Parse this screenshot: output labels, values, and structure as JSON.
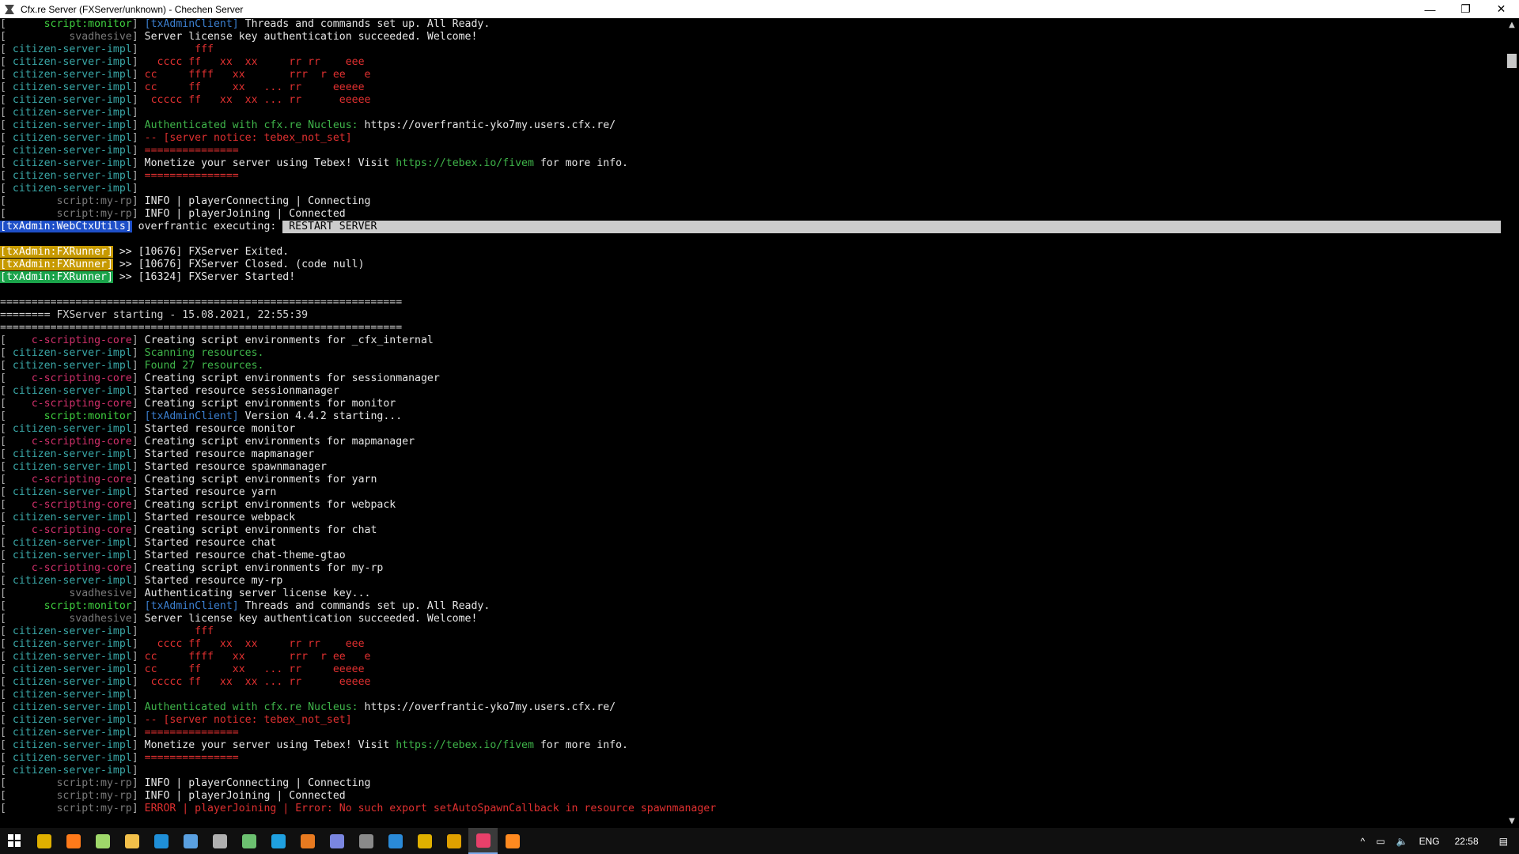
{
  "window": {
    "title": "Cfx.re Server (FXServer/unknown) - Chechen Server",
    "minimize": "—",
    "maximize": "❐",
    "close": "✕"
  },
  "console": {
    "lines": [
      [
        [
          "[      ",
          "b"
        ],
        [
          "script:monitor",
          "monitor"
        ],
        [
          "] ",
          "b"
        ],
        [
          "[txAdminClient]",
          "client"
        ],
        [
          " Threads and commands set up. All Ready.",
          "white"
        ]
      ],
      [
        [
          "[          ",
          "b"
        ],
        [
          "svadhesive",
          "svad"
        ],
        [
          "] ",
          "b"
        ],
        [
          "Server license key authentication succeeded. Welcome!",
          "white"
        ]
      ],
      [
        [
          "[ ",
          "b"
        ],
        [
          "citizen-server-impl",
          "csi"
        ],
        [
          "] ",
          "b"
        ],
        [
          "        fff",
          "red"
        ]
      ],
      [
        [
          "[ ",
          "b"
        ],
        [
          "citizen-server-impl",
          "csi"
        ],
        [
          "] ",
          "b"
        ],
        [
          "  cccc ff   xx  xx     rr rr    eee",
          "red"
        ]
      ],
      [
        [
          "[ ",
          "b"
        ],
        [
          "citizen-server-impl",
          "csi"
        ],
        [
          "] ",
          "b"
        ],
        [
          "cc     ffff   xx       rrr  r ee   e",
          "red"
        ]
      ],
      [
        [
          "[ ",
          "b"
        ],
        [
          "citizen-server-impl",
          "csi"
        ],
        [
          "] ",
          "b"
        ],
        [
          "cc     ff     xx   ... rr     eeeee",
          "red"
        ]
      ],
      [
        [
          "[ ",
          "b"
        ],
        [
          "citizen-server-impl",
          "csi"
        ],
        [
          "] ",
          "b"
        ],
        [
          " ccccc ff   xx  xx ... rr      eeeee",
          "red"
        ]
      ],
      [
        [
          "[ ",
          "b"
        ],
        [
          "citizen-server-impl",
          "csi"
        ],
        [
          "]",
          "b"
        ]
      ],
      [
        [
          "[ ",
          "b"
        ],
        [
          "citizen-server-impl",
          "csi"
        ],
        [
          "] ",
          "b"
        ],
        [
          "Authenticated with cfx.re Nucleus: ",
          "green"
        ],
        [
          "https://overfrantic-yko7my.users.cfx.re/",
          "white"
        ]
      ],
      [
        [
          "[ ",
          "b"
        ],
        [
          "citizen-server-impl",
          "csi"
        ],
        [
          "] ",
          "b"
        ],
        [
          "-- [server notice: tebex_not_set]",
          "red"
        ]
      ],
      [
        [
          "[ ",
          "b"
        ],
        [
          "citizen-server-impl",
          "csi"
        ],
        [
          "] ",
          "b"
        ],
        [
          "===============",
          "red"
        ]
      ],
      [
        [
          "[ ",
          "b"
        ],
        [
          "citizen-server-impl",
          "csi"
        ],
        [
          "] ",
          "b"
        ],
        [
          "Monetize your server using Tebex! Visit ",
          "white"
        ],
        [
          "https://tebex.io/fivem",
          "green"
        ],
        [
          " for more info.",
          "white"
        ]
      ],
      [
        [
          "[ ",
          "b"
        ],
        [
          "citizen-server-impl",
          "csi"
        ],
        [
          "] ",
          "b"
        ],
        [
          "===============",
          "red"
        ]
      ],
      [
        [
          "[ ",
          "b"
        ],
        [
          "citizen-server-impl",
          "csi"
        ],
        [
          "]",
          "b"
        ]
      ],
      [
        [
          "[        ",
          "b"
        ],
        [
          "script:my-rp",
          "myrp"
        ],
        [
          "] ",
          "b"
        ],
        [
          "INFO | playerConnecting | Connecting",
          "white"
        ]
      ],
      [
        [
          "[        ",
          "b"
        ],
        [
          "script:my-rp",
          "myrp"
        ],
        [
          "] ",
          "b"
        ],
        [
          "INFO | playerJoining | Connected",
          "white"
        ]
      ],
      [
        [
          "[txAdmin:WebCtxUtils]",
          "webctx"
        ],
        [
          " overfrantic executing: ",
          "white"
        ],
        [
          " RESTART SERVER",
          "cmd"
        ]
      ],
      [],
      [
        [
          "[txAdmin:FXRunner]",
          "fxr-y"
        ],
        [
          " >> [10676] FXServer Exited.",
          "white"
        ]
      ],
      [
        [
          "[txAdmin:FXRunner]",
          "fxr-y"
        ],
        [
          " >> [10676] FXServer Closed. (code null)",
          "white"
        ]
      ],
      [
        [
          "[txAdmin:FXRunner]",
          "fxr-g"
        ],
        [
          " >> [16324] FXServer Started!",
          "white"
        ]
      ],
      [],
      [
        [
          "================================================================",
          "sep"
        ]
      ],
      [
        [
          "======== FXServer starting - 15.08.2021, 22:55:39",
          "sep"
        ]
      ],
      [
        [
          "================================================================",
          "sep"
        ]
      ],
      [
        [
          "[    ",
          "b"
        ],
        [
          "c-scripting-core",
          "core"
        ],
        [
          "] ",
          "b"
        ],
        [
          "Creating script environments for _cfx_internal",
          "white"
        ]
      ],
      [
        [
          "[ ",
          "b"
        ],
        [
          "citizen-server-impl",
          "csi"
        ],
        [
          "] ",
          "b"
        ],
        [
          "Scanning resources.",
          "green"
        ]
      ],
      [
        [
          "[ ",
          "b"
        ],
        [
          "citizen-server-impl",
          "csi"
        ],
        [
          "] ",
          "b"
        ],
        [
          "Found 27 resources.",
          "green"
        ]
      ],
      [
        [
          "[    ",
          "b"
        ],
        [
          "c-scripting-core",
          "core"
        ],
        [
          "] ",
          "b"
        ],
        [
          "Creating script environments for sessionmanager",
          "white"
        ]
      ],
      [
        [
          "[ ",
          "b"
        ],
        [
          "citizen-server-impl",
          "csi"
        ],
        [
          "] ",
          "b"
        ],
        [
          "Started resource sessionmanager",
          "white"
        ]
      ],
      [
        [
          "[    ",
          "b"
        ],
        [
          "c-scripting-core",
          "core"
        ],
        [
          "] ",
          "b"
        ],
        [
          "Creating script environments for monitor",
          "white"
        ]
      ],
      [
        [
          "[      ",
          "b"
        ],
        [
          "script:monitor",
          "monitor"
        ],
        [
          "] ",
          "b"
        ],
        [
          "[txAdminClient]",
          "client"
        ],
        [
          " Version 4.4.2 starting...",
          "white"
        ]
      ],
      [
        [
          "[ ",
          "b"
        ],
        [
          "citizen-server-impl",
          "csi"
        ],
        [
          "] ",
          "b"
        ],
        [
          "Started resource monitor",
          "white"
        ]
      ],
      [
        [
          "[    ",
          "b"
        ],
        [
          "c-scripting-core",
          "core"
        ],
        [
          "] ",
          "b"
        ],
        [
          "Creating script environments for mapmanager",
          "white"
        ]
      ],
      [
        [
          "[ ",
          "b"
        ],
        [
          "citizen-server-impl",
          "csi"
        ],
        [
          "] ",
          "b"
        ],
        [
          "Started resource mapmanager",
          "white"
        ]
      ],
      [
        [
          "[ ",
          "b"
        ],
        [
          "citizen-server-impl",
          "csi"
        ],
        [
          "] ",
          "b"
        ],
        [
          "Started resource spawnmanager",
          "white"
        ]
      ],
      [
        [
          "[    ",
          "b"
        ],
        [
          "c-scripting-core",
          "core"
        ],
        [
          "] ",
          "b"
        ],
        [
          "Creating script environments for yarn",
          "white"
        ]
      ],
      [
        [
          "[ ",
          "b"
        ],
        [
          "citizen-server-impl",
          "csi"
        ],
        [
          "] ",
          "b"
        ],
        [
          "Started resource yarn",
          "white"
        ]
      ],
      [
        [
          "[    ",
          "b"
        ],
        [
          "c-scripting-core",
          "core"
        ],
        [
          "] ",
          "b"
        ],
        [
          "Creating script environments for webpack",
          "white"
        ]
      ],
      [
        [
          "[ ",
          "b"
        ],
        [
          "citizen-server-impl",
          "csi"
        ],
        [
          "] ",
          "b"
        ],
        [
          "Started resource webpack",
          "white"
        ]
      ],
      [
        [
          "[    ",
          "b"
        ],
        [
          "c-scripting-core",
          "core"
        ],
        [
          "] ",
          "b"
        ],
        [
          "Creating script environments for chat",
          "white"
        ]
      ],
      [
        [
          "[ ",
          "b"
        ],
        [
          "citizen-server-impl",
          "csi"
        ],
        [
          "] ",
          "b"
        ],
        [
          "Started resource chat",
          "white"
        ]
      ],
      [
        [
          "[ ",
          "b"
        ],
        [
          "citizen-server-impl",
          "csi"
        ],
        [
          "] ",
          "b"
        ],
        [
          "Started resource chat-theme-gtao",
          "white"
        ]
      ],
      [
        [
          "[    ",
          "b"
        ],
        [
          "c-scripting-core",
          "core"
        ],
        [
          "] ",
          "b"
        ],
        [
          "Creating script environments for my-rp",
          "white"
        ]
      ],
      [
        [
          "[ ",
          "b"
        ],
        [
          "citizen-server-impl",
          "csi"
        ],
        [
          "] ",
          "b"
        ],
        [
          "Started resource my-rp",
          "white"
        ]
      ],
      [
        [
          "[          ",
          "b"
        ],
        [
          "svadhesive",
          "svad"
        ],
        [
          "] ",
          "b"
        ],
        [
          "Authenticating server license key...",
          "white"
        ]
      ],
      [
        [
          "[      ",
          "b"
        ],
        [
          "script:monitor",
          "monitor"
        ],
        [
          "] ",
          "b"
        ],
        [
          "[txAdminClient]",
          "client"
        ],
        [
          " Threads and commands set up. All Ready.",
          "white"
        ]
      ],
      [
        [
          "[          ",
          "b"
        ],
        [
          "svadhesive",
          "svad"
        ],
        [
          "] ",
          "b"
        ],
        [
          "Server license key authentication succeeded. Welcome!",
          "white"
        ]
      ],
      [
        [
          "[ ",
          "b"
        ],
        [
          "citizen-server-impl",
          "csi"
        ],
        [
          "] ",
          "b"
        ],
        [
          "        fff",
          "red"
        ]
      ],
      [
        [
          "[ ",
          "b"
        ],
        [
          "citizen-server-impl",
          "csi"
        ],
        [
          "] ",
          "b"
        ],
        [
          "  cccc ff   xx  xx     rr rr    eee",
          "red"
        ]
      ],
      [
        [
          "[ ",
          "b"
        ],
        [
          "citizen-server-impl",
          "csi"
        ],
        [
          "] ",
          "b"
        ],
        [
          "cc     ffff   xx       rrr  r ee   e",
          "red"
        ]
      ],
      [
        [
          "[ ",
          "b"
        ],
        [
          "citizen-server-impl",
          "csi"
        ],
        [
          "] ",
          "b"
        ],
        [
          "cc     ff     xx   ... rr     eeeee",
          "red"
        ]
      ],
      [
        [
          "[ ",
          "b"
        ],
        [
          "citizen-server-impl",
          "csi"
        ],
        [
          "] ",
          "b"
        ],
        [
          " ccccc ff   xx  xx ... rr      eeeee",
          "red"
        ]
      ],
      [
        [
          "[ ",
          "b"
        ],
        [
          "citizen-server-impl",
          "csi"
        ],
        [
          "]",
          "b"
        ]
      ],
      [
        [
          "[ ",
          "b"
        ],
        [
          "citizen-server-impl",
          "csi"
        ],
        [
          "] ",
          "b"
        ],
        [
          "Authenticated with cfx.re Nucleus: ",
          "green"
        ],
        [
          "https://overfrantic-yko7my.users.cfx.re/",
          "white"
        ]
      ],
      [
        [
          "[ ",
          "b"
        ],
        [
          "citizen-server-impl",
          "csi"
        ],
        [
          "] ",
          "b"
        ],
        [
          "-- [server notice: tebex_not_set]",
          "red"
        ]
      ],
      [
        [
          "[ ",
          "b"
        ],
        [
          "citizen-server-impl",
          "csi"
        ],
        [
          "] ",
          "b"
        ],
        [
          "===============",
          "red"
        ]
      ],
      [
        [
          "[ ",
          "b"
        ],
        [
          "citizen-server-impl",
          "csi"
        ],
        [
          "] ",
          "b"
        ],
        [
          "Monetize your server using Tebex! Visit ",
          "white"
        ],
        [
          "https://tebex.io/fivem",
          "green"
        ],
        [
          " for more info.",
          "white"
        ]
      ],
      [
        [
          "[ ",
          "b"
        ],
        [
          "citizen-server-impl",
          "csi"
        ],
        [
          "] ",
          "b"
        ],
        [
          "===============",
          "red"
        ]
      ],
      [
        [
          "[ ",
          "b"
        ],
        [
          "citizen-server-impl",
          "csi"
        ],
        [
          "]",
          "b"
        ]
      ],
      [
        [
          "[        ",
          "b"
        ],
        [
          "script:my-rp",
          "myrp"
        ],
        [
          "] ",
          "b"
        ],
        [
          "INFO | playerConnecting | Connecting",
          "white"
        ]
      ],
      [
        [
          "[        ",
          "b"
        ],
        [
          "script:my-rp",
          "myrp"
        ],
        [
          "] ",
          "b"
        ],
        [
          "INFO | playerJoining | Connected",
          "white"
        ]
      ],
      [
        [
          "[        ",
          "b"
        ],
        [
          "script:my-rp",
          "myrp"
        ],
        [
          "] ",
          "b"
        ],
        [
          "ERROR | playerJoining | Error: No such export setAutoSpawnCallback in resource spawnmanager",
          "red"
        ]
      ],
      [],
      [
        [
          "_",
          "white"
        ]
      ]
    ]
  },
  "taskbar": {
    "icons": [
      {
        "name": "start-icon",
        "color": "#ffffff"
      },
      {
        "name": "chrome-icon",
        "color": "#e0b000"
      },
      {
        "name": "firefox-icon",
        "color": "#ff7a1a"
      },
      {
        "name": "notepad-icon",
        "color": "#9fd86a"
      },
      {
        "name": "explorer-icon",
        "color": "#f2c04a"
      },
      {
        "name": "photoshop-icon",
        "color": "#1f8fd8"
      },
      {
        "name": "cloud-app-icon",
        "color": "#5aa0e0"
      },
      {
        "name": "tool-icon",
        "color": "#b0b0b0"
      },
      {
        "name": "terminal-app-icon",
        "color": "#6cc070"
      },
      {
        "name": "skype-icon",
        "color": "#1fa0e0"
      },
      {
        "name": "media-app-icon",
        "color": "#e87a20"
      },
      {
        "name": "discord-icon",
        "color": "#7a86e0"
      },
      {
        "name": "steam-icon",
        "color": "#8a8a8a"
      },
      {
        "name": "vscode-icon",
        "color": "#2a8ad8"
      },
      {
        "name": "rockstar-icon",
        "color": "#e0b000"
      },
      {
        "name": "rockstar-launcher-icon",
        "color": "#e0a000"
      },
      {
        "name": "fxserver-icon",
        "color": "#e8406a",
        "active": true
      },
      {
        "name": "sublime-icon",
        "color": "#ff8a20"
      }
    ],
    "tray": {
      "chevron": "^",
      "network": "▭",
      "volume": "🔈",
      "language": "ENG",
      "clock": "22:58",
      "notifications": "▤"
    }
  }
}
